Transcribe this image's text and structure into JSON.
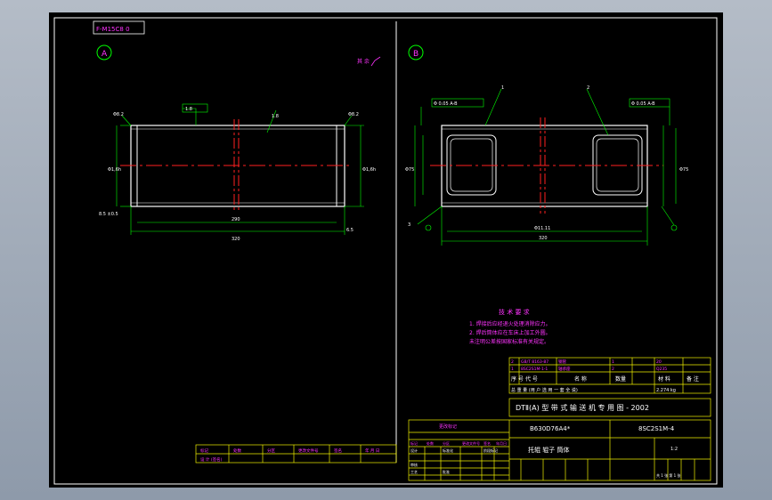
{
  "drawing_code_tag": "F-M15C8 0",
  "views": {
    "a": {
      "label": "A"
    },
    "b": {
      "label": "B"
    }
  },
  "surface_symbol": "其 余",
  "view_a": {
    "balloon_top": "1.8",
    "dims": {
      "left_top": "Φ8.2",
      "right_top": "Φ8.2",
      "left_dia": "Φ1,6h",
      "right_dia": "Φ1,6h",
      "inner": "290",
      "overall": "320",
      "left_end": "8.5",
      "bottom_left": "8.5 ±0.5",
      "right_end": "6.5",
      "wall": "1.8"
    }
  },
  "view_b": {
    "box_left": "Φ 0.05 A-B",
    "box_right": "Φ 0.05 A-B",
    "leader_1": "1",
    "leader_2": "2",
    "leader_3": "3",
    "dims": {
      "left_dia": "Φ75",
      "right_dia": "Φ75",
      "inner_len": "Φ11.11",
      "overall": "320"
    }
  },
  "tech_requirements": {
    "heading": "技 术 要 求",
    "lines": [
      "1. 焊接后应经退火处理消除应力。",
      "2. 焊后筒体应在车床上加工外圆。",
      "   未注明公差按国家标准有关规定。"
    ]
  },
  "title_block": {
    "header_cols": [
      "序 号",
      "代 号",
      "名 称",
      "数量",
      "材 料",
      "备 注"
    ],
    "parts_rows": [
      [
        "2",
        "GB/T 8163-87",
        "钢管",
        "1",
        "20",
        ""
      ],
      [
        "1",
        "8SC2S1M-1-1",
        "轴承座",
        "2",
        "Q235",
        ""
      ]
    ],
    "spec_row": "总 重 量  (用 户 选 用 一 套 全 说)",
    "weight": "2.274 kg",
    "standard_title": "DTⅡ(A) 型 带 式 输 送 机 专 用 图 - 2002",
    "code_left": "B630D76A4*",
    "code_right": "8SC2S1M-4",
    "part_name": "托辊 辊子 筒体",
    "scale": "1:2",
    "sheet": "共 1 张  第 1 张"
  },
  "revision_block": {
    "title": "更改标记",
    "rows": [
      [
        "标记",
        "处数",
        "分区",
        "更改文件号",
        "签名",
        "年月日"
      ],
      [
        "设计",
        "",
        "标准化",
        "",
        "阶段标记",
        ""
      ],
      [
        "审核",
        "",
        "",
        "",
        "",
        ""
      ],
      [
        "工艺",
        "",
        "批准",
        "",
        "",
        ""
      ]
    ]
  },
  "bottom_strip": {
    "cells": [
      "标记",
      "处数",
      "分区",
      "更改文件号",
      "签名",
      "年 月 日"
    ],
    "cells2": [
      "设 计 (签名)",
      "",
      "",
      "",
      "",
      ""
    ]
  }
}
